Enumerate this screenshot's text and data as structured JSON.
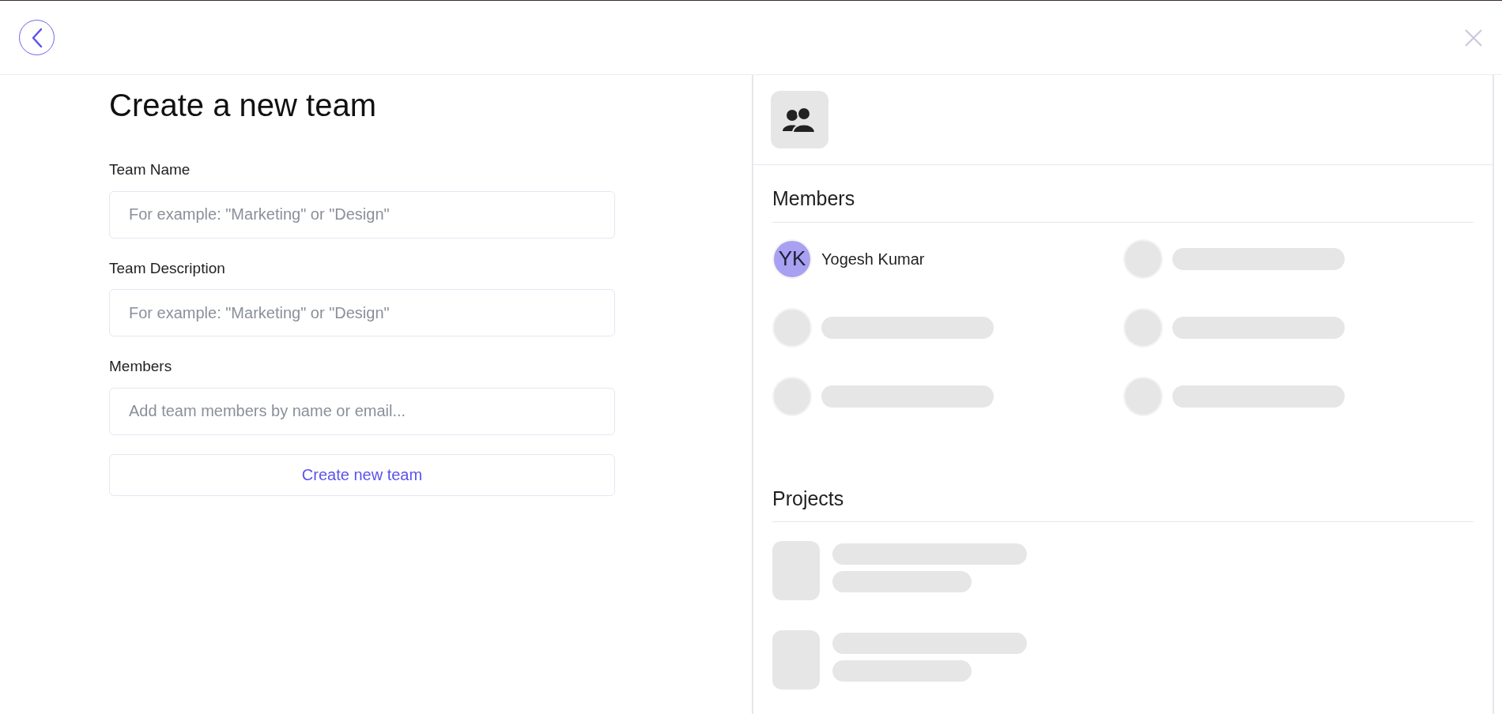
{
  "form": {
    "title": "Create a new team",
    "fields": [
      {
        "label": "Team Name",
        "placeholder": "For example: \"Marketing\" or \"Design\""
      },
      {
        "label": "Team Description",
        "placeholder": "For example: \"Marketing\" or \"Design\""
      },
      {
        "label": "Members",
        "placeholder": "Add team members by name or email..."
      }
    ],
    "submit": "Create new team"
  },
  "preview": {
    "members_heading": "Members",
    "members": [
      {
        "kind": "person",
        "initials": "YK",
        "name": "Yogesh Kumar"
      },
      {
        "kind": "placeholder"
      },
      {
        "kind": "placeholder"
      },
      {
        "kind": "placeholder"
      },
      {
        "kind": "placeholder"
      },
      {
        "kind": "placeholder"
      }
    ],
    "projects_heading": "Projects",
    "projects": [
      {
        "kind": "placeholder"
      },
      {
        "kind": "placeholder"
      }
    ]
  }
}
